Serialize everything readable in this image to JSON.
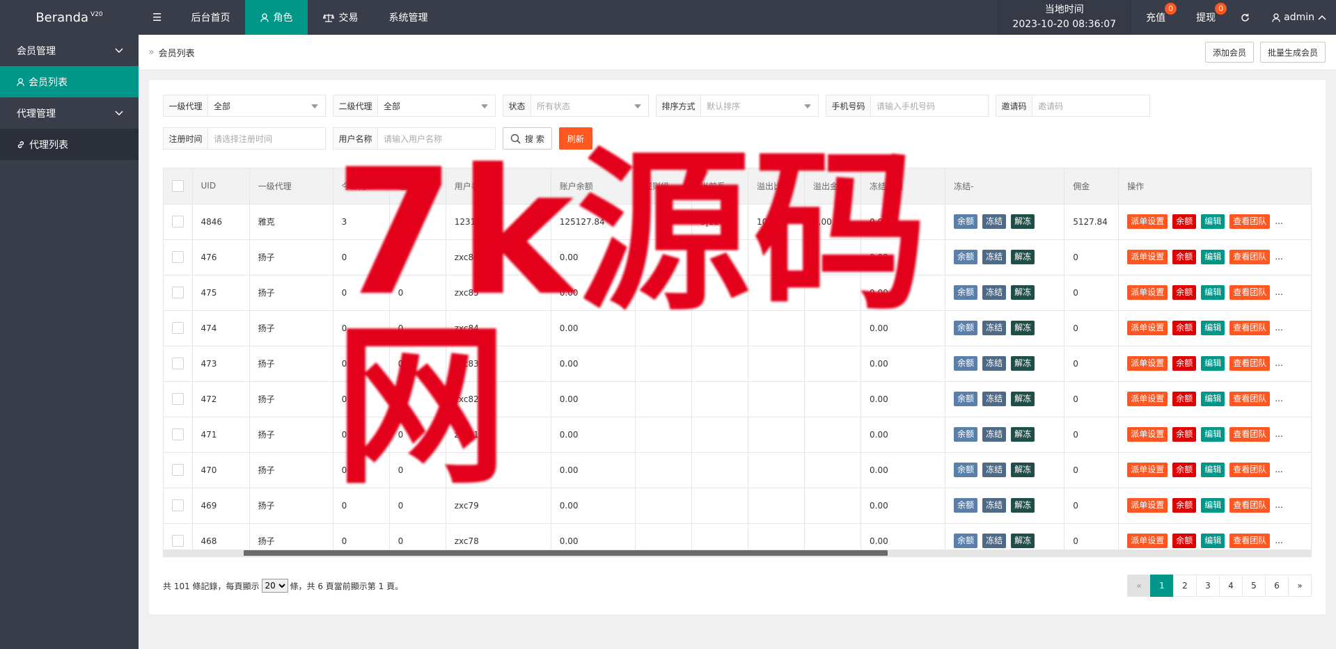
{
  "app": {
    "logo": "Beranda",
    "version": "V20"
  },
  "topnav": {
    "items": [
      {
        "label": "后台首页"
      },
      {
        "label": "角色"
      },
      {
        "label": "交易"
      },
      {
        "label": "系统管理"
      }
    ],
    "time_label": "当地时间",
    "time_value": "2023-10-20 08:36:07",
    "recharge_label": "充值",
    "recharge_badge": "0",
    "withdraw_label": "提现",
    "withdraw_badge": "0",
    "user": "admin"
  },
  "sidebar": {
    "groups": [
      {
        "label": "会员管理",
        "item": "会员列表"
      },
      {
        "label": "代理管理",
        "item": "代理列表"
      }
    ]
  },
  "breadcrumb": {
    "current": "会员列表",
    "add_member": "添加会员",
    "batch_generate": "批量生成会员"
  },
  "filters": {
    "agent1_label": "一级代理",
    "agent1_value": "全部",
    "agent2_label": "二级代理",
    "agent2_value": "全部",
    "status_label": "状态",
    "status_placeholder": "所有状态",
    "sort_label": "排序方式",
    "sort_placeholder": "默认排序",
    "phone_label": "手机号码",
    "phone_placeholder": "请输入手机号码",
    "invite_label": "邀请码",
    "invite_placeholder": "邀请码",
    "regtime_label": "注册时间",
    "regtime_placeholder": "请选择注册时间",
    "username_label": "用户名称",
    "username_placeholder": "请输入用户名称",
    "search_label": "搜 索",
    "refresh_label": "刷新"
  },
  "table": {
    "headers": [
      "UID",
      "一级代理",
      "今日抢...",
      "组次数",
      "用户名",
      "账户余额",
      "规则组",
      "当前系...",
      "溢出比率",
      "溢出金额",
      "冻结金额",
      "冻结-",
      "佣金",
      "操作"
    ],
    "btn_balance": "余额",
    "btn_freeze": "冻结",
    "btn_unfreeze": "解冻",
    "op_dispatch": "派单设置",
    "op_balance": "余额",
    "op_edit": "编辑",
    "op_team": "查看团队",
    "op_more": "...",
    "rows": [
      {
        "uid": "4846",
        "agent": "雅克",
        "today": "3",
        "groups": "0",
        "username": "123123",
        "balance": "125127.84",
        "rule": "2",
        "current": "5|12",
        "overflow_rate": "10",
        "overflow_amount": "0.00",
        "frozen": "0.00",
        "commission": "5127.84"
      },
      {
        "uid": "476",
        "agent": "扬子",
        "today": "0",
        "groups": "0",
        "username": "zxc86",
        "balance": "0.00",
        "rule": "",
        "current": "",
        "overflow_rate": "",
        "overflow_amount": "",
        "frozen": "0.00",
        "commission": "0"
      },
      {
        "uid": "475",
        "agent": "扬子",
        "today": "0",
        "groups": "0",
        "username": "zxc85",
        "balance": "0.00",
        "rule": "",
        "current": "",
        "overflow_rate": "",
        "overflow_amount": "",
        "frozen": "0.00",
        "commission": "0"
      },
      {
        "uid": "474",
        "agent": "扬子",
        "today": "0",
        "groups": "0",
        "username": "zxc84",
        "balance": "0.00",
        "rule": "",
        "current": "",
        "overflow_rate": "",
        "overflow_amount": "",
        "frozen": "0.00",
        "commission": "0"
      },
      {
        "uid": "473",
        "agent": "扬子",
        "today": "0",
        "groups": "0",
        "username": "zxc83",
        "balance": "0.00",
        "rule": "",
        "current": "",
        "overflow_rate": "",
        "overflow_amount": "",
        "frozen": "0.00",
        "commission": "0"
      },
      {
        "uid": "472",
        "agent": "扬子",
        "today": "0",
        "groups": "0",
        "username": "zxc82",
        "balance": "0.00",
        "rule": "",
        "current": "",
        "overflow_rate": "",
        "overflow_amount": "",
        "frozen": "0.00",
        "commission": "0"
      },
      {
        "uid": "471",
        "agent": "扬子",
        "today": "0",
        "groups": "0",
        "username": "zxc81",
        "balance": "0.00",
        "rule": "",
        "current": "",
        "overflow_rate": "",
        "overflow_amount": "",
        "frozen": "0.00",
        "commission": "0"
      },
      {
        "uid": "470",
        "agent": "扬子",
        "today": "0",
        "groups": "0",
        "username": "zxc80",
        "balance": "0.00",
        "rule": "",
        "current": "",
        "overflow_rate": "",
        "overflow_amount": "",
        "frozen": "0.00",
        "commission": "0"
      },
      {
        "uid": "469",
        "agent": "扬子",
        "today": "0",
        "groups": "0",
        "username": "zxc79",
        "balance": "0.00",
        "rule": "",
        "current": "",
        "overflow_rate": "",
        "overflow_amount": "",
        "frozen": "0.00",
        "commission": "0"
      },
      {
        "uid": "468",
        "agent": "扬子",
        "today": "0",
        "groups": "0",
        "username": "zxc78",
        "balance": "0.00",
        "rule": "",
        "current": "",
        "overflow_rate": "",
        "overflow_amount": "",
        "frozen": "0.00",
        "commission": "0"
      }
    ]
  },
  "pagination": {
    "info_prefix": "共 101 條記錄，每頁顯示",
    "page_size": "20",
    "info_suffix": "條，共 6 頁當前顯示第 1 頁。",
    "prev": "«",
    "pages": [
      "1",
      "2",
      "3",
      "4",
      "5",
      "6"
    ],
    "next": "»"
  },
  "watermark": "7k源码网"
}
